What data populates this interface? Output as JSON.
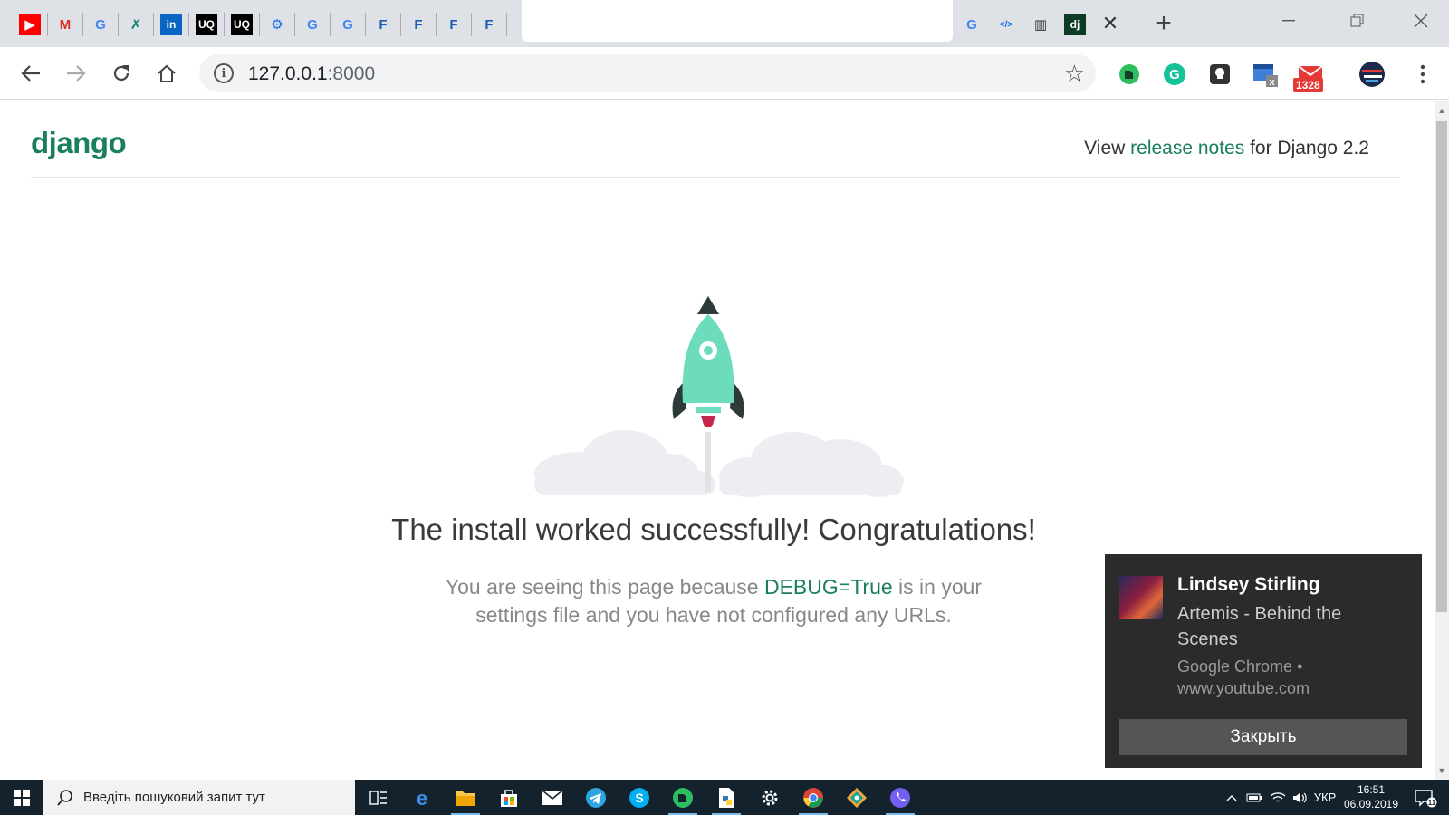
{
  "browser": {
    "tab_favicons": [
      {
        "name": "youtube-icon",
        "glyph": "▶",
        "bg": "#ff0000",
        "fg": "#ffffff"
      },
      {
        "name": "gmail-icon",
        "glyph": "M",
        "bg": "transparent",
        "fg": "#d93025"
      },
      {
        "name": "google-icon",
        "glyph": "G",
        "bg": "transparent",
        "fg": "#4285f4"
      },
      {
        "name": "xing-icon",
        "glyph": "✗",
        "bg": "transparent",
        "fg": "#0a8275"
      },
      {
        "name": "linkedin-icon",
        "glyph": "in",
        "bg": "#0a66c2",
        "fg": "#ffffff"
      },
      {
        "name": "uq-icon",
        "glyph": "UQ",
        "bg": "#000000",
        "fg": "#ffffff"
      },
      {
        "name": "uq-icon",
        "glyph": "UQ",
        "bg": "#000000",
        "fg": "#ffffff"
      },
      {
        "name": "settings-gear-icon",
        "glyph": "⚙",
        "bg": "transparent",
        "fg": "#1a73e8"
      },
      {
        "name": "google-icon",
        "glyph": "G",
        "bg": "transparent",
        "fg": "#4285f4"
      },
      {
        "name": "google-icon",
        "glyph": "G",
        "bg": "transparent",
        "fg": "#4285f4"
      },
      {
        "name": "f-star-icon",
        "glyph": "F",
        "bg": "transparent",
        "fg": "#1a5fb4"
      },
      {
        "name": "f-star-icon",
        "glyph": "F",
        "bg": "transparent",
        "fg": "#1a5fb4"
      },
      {
        "name": "f-star-icon",
        "glyph": "F",
        "bg": "transparent",
        "fg": "#1a5fb4"
      },
      {
        "name": "f-star-icon",
        "glyph": "F",
        "bg": "transparent",
        "fg": "#1a5fb4"
      }
    ],
    "tab_favicons_right": [
      {
        "name": "google-icon",
        "glyph": "G",
        "bg": "transparent",
        "fg": "#4285f4"
      },
      {
        "name": "code-icon",
        "glyph": "</>",
        "bg": "transparent",
        "fg": "#1a73e8"
      },
      {
        "name": "reader-icon",
        "glyph": "▥",
        "bg": "transparent",
        "fg": "#333333"
      },
      {
        "name": "django-icon",
        "glyph": "dj",
        "bg": "#0c3c26",
        "fg": "#ffffff"
      }
    ],
    "tab_close": "✕",
    "new_tab": "+",
    "url_host": "127.0.0.1",
    "url_port": ":8000"
  },
  "page": {
    "logo": "django",
    "release_prefix": "View ",
    "release_link": "release notes",
    "release_suffix": " for Django 2.2",
    "headline": "The install worked successfully! Congratulations!",
    "body_prefix": "You are seeing this page because ",
    "body_debug": "DEBUG=True",
    "body_suffix": " is in your settings file and you have not configured any URLs."
  },
  "notification": {
    "title": "Lindsey Stirling",
    "body": "Artemis - Behind the Scenes",
    "source": "Google Chrome • www.youtube.com",
    "button": "Закрыть"
  },
  "taskbar": {
    "search_placeholder": "Введіть пошуковий запит тут",
    "lang": "УКР",
    "time": "16:51",
    "date": "06.09.2019",
    "notif_count": "11"
  },
  "extensions": {
    "mail_badge": "1328"
  },
  "colors": {
    "django_green": "#1a7f5a",
    "rocket_body": "#6ddcbd",
    "rocket_dark": "#2e3a3a",
    "flame": "#c8254a"
  }
}
